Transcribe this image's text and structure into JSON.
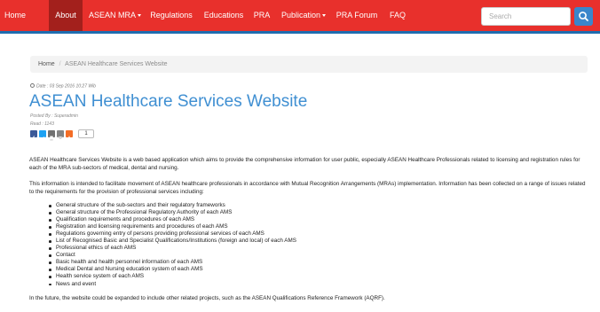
{
  "nav": {
    "items": [
      {
        "label": "Home"
      },
      {
        "label": "About"
      },
      {
        "label": "ASEAN MRA"
      },
      {
        "label": "Regulations"
      },
      {
        "label": "Educations"
      },
      {
        "label": "PRA"
      },
      {
        "label": "Publication"
      },
      {
        "label": "PRA Forum"
      },
      {
        "label": "FAQ"
      }
    ],
    "active": "About",
    "search_placeholder": "Search"
  },
  "breadcrumb": {
    "home": "Home",
    "separator": "/",
    "current": "ASEAN Healthcare Services Website"
  },
  "article": {
    "date": "Date : 03 Sep 2016 10:27 Wib",
    "title": "ASEAN Healthcare Services Website",
    "posted_by": "Posted By : Superadmin",
    "read": "Read : 1143",
    "share_count": "1",
    "intro": "ASEAN Healthcare Services Website is a web based application which aims to provide the comprehensive information for user public, especially ASEAN Healthcare Professionals related to licensing and registration rules for each of the MRA sub-sectors of medical, dental and nursing.",
    "purpose": "This information is intended to facilitate movement of ASEAN healthcare professionals in accordance with Mutual Recognition Arrangements (MRAs) implementation. Information has been collected on a range of issues related to the requirements for the provision of professional services including:",
    "items": [
      "General structure of the sub-sectors and their regulatory frameworks",
      "General structure of the Professional Regulatory Authority of each AMS",
      "Qualification requirements and procedures of each AMS",
      "Registration and licensing requirements and procedures of each AMS",
      "Regulations governing entry of persons providing professional services of each AMS",
      "List of Recognised Basic and Specialist Qualifications/Institutions (foreign and local) of each AMS",
      "Professional ethics of each AMS",
      "Contact",
      "Basic health and health personnel information of each AMS",
      "Medical Dental and Nursing education system of each AMS",
      "Health service system of each AMS",
      "News and event"
    ],
    "future": "In the future, the website could be expanded to include other related projects, such as the ASEAN Qualifications Reference Framework (AQRF)."
  },
  "colors": {
    "navbar": "#e8302c",
    "nav_active": "#a3201c",
    "nav_border": "#1f6db0",
    "title": "#3f8fd2",
    "search_button": "#3a86cb"
  }
}
